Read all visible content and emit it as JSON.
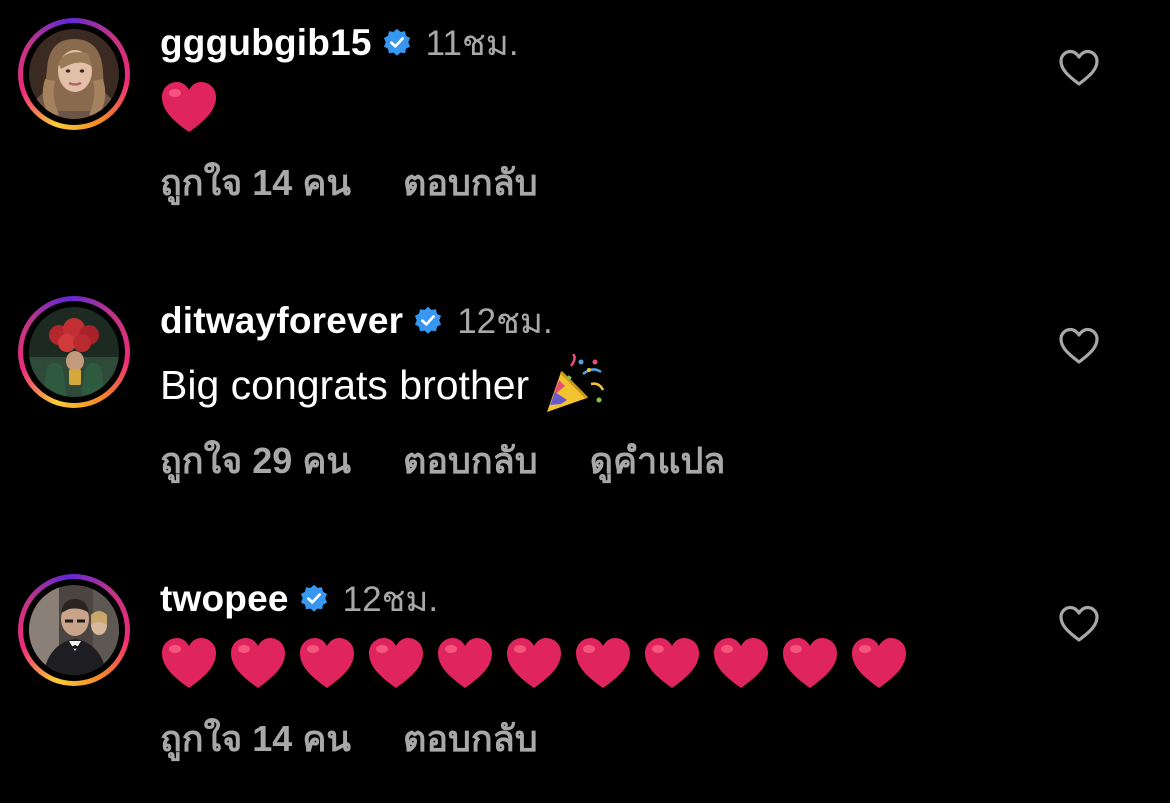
{
  "comments": [
    {
      "username": "gggubgib15",
      "time": "11ชม.",
      "text": "",
      "hearts": 1,
      "party": false,
      "likes": "ถูกใจ 14 คน",
      "reply": "ตอบกลับ",
      "translate": ""
    },
    {
      "username": "ditwayforever",
      "time": "12ชม.",
      "text": "Big congrats brother",
      "hearts": 0,
      "party": true,
      "likes": "ถูกใจ 29 คน",
      "reply": "ตอบกลับ",
      "translate": "ดูคำแปล"
    },
    {
      "username": "twopee",
      "time": "12ชม.",
      "text": "",
      "hearts": 11,
      "party": false,
      "likes": "ถูกใจ 14 คน",
      "reply": "ตอบกลับ",
      "translate": ""
    }
  ],
  "icons": {
    "verified": "verified-badge-icon",
    "like": "heart-outline-icon",
    "heart_emoji": "red-heart-emoji",
    "party_emoji": "party-popper-emoji"
  },
  "colors": {
    "background": "#000000",
    "text": "#ffffff",
    "secondary": "#a8a8a8",
    "verified": "#3897f0",
    "heart": "#e0245e"
  }
}
